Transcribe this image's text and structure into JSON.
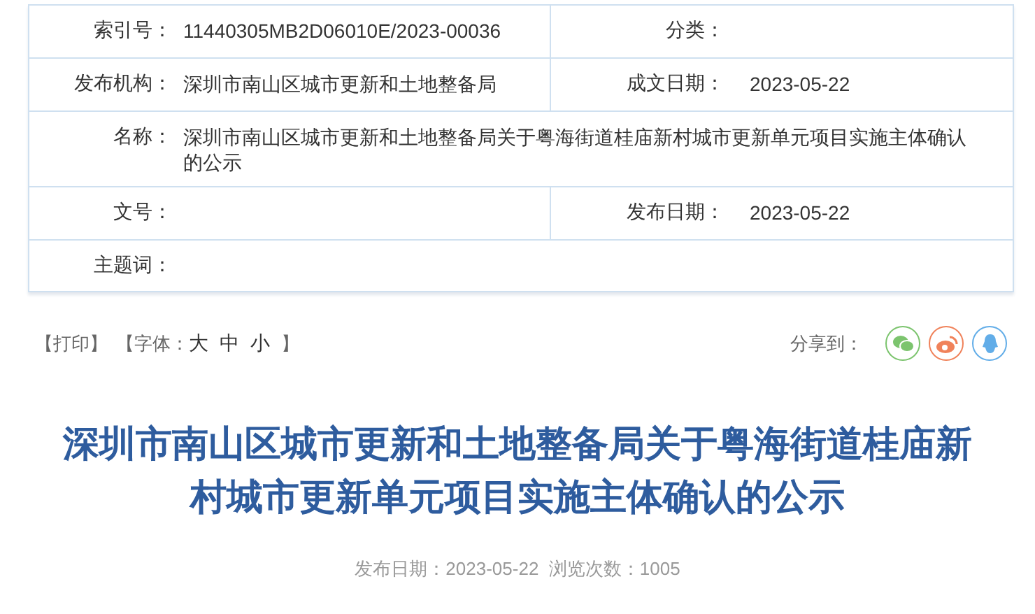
{
  "info_table": {
    "rows": [
      {
        "kind": "pair",
        "cells": [
          {
            "label": "索引号：",
            "value": "11440305MB2D06010E/2023-00036"
          },
          {
            "label": "分类："
          }
        ]
      },
      {
        "kind": "pair",
        "cells": [
          {
            "label": "发布机构：",
            "value": "深圳市南山区城市更新和土地整备局"
          },
          {
            "label": "成文日期：",
            "value": "2023-05-22"
          }
        ]
      },
      {
        "kind": "wide",
        "cells": [
          {
            "label": "名称：",
            "value": "深圳市南山区城市更新和土地整备局关于粤海街道桂庙新村城市更新单元项目实施主体确认的公示"
          }
        ]
      },
      {
        "kind": "pair",
        "cells": [
          {
            "label": "文号："
          },
          {
            "label": "发布日期：",
            "value": "2023-05-22"
          }
        ]
      },
      {
        "kind": "wide",
        "cells": [
          {
            "label": "主题词："
          }
        ]
      }
    ]
  },
  "toolbar": {
    "print_link": "【打印】",
    "font_label": "【字体：",
    "font_sizes": [
      "大",
      "中",
      "小"
    ],
    "font_close": "】",
    "share_label": "分享到：",
    "share_buttons": [
      {
        "kind": "wechat",
        "color": "#7cc46e"
      },
      {
        "kind": "weibo",
        "color": "#f0825a"
      },
      {
        "kind": "qq",
        "color": "#62ade8"
      }
    ]
  },
  "article": {
    "title": "深圳市南山区城市更新和土地整备局关于粤海街道桂庙新村城市更新单元项目实施主体确认的公示",
    "meta": "发布日期：2023-05-22  浏览次数：1005"
  }
}
